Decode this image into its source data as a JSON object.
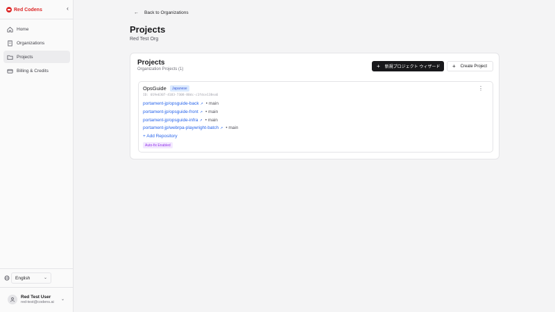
{
  "brand": {
    "name": "Red Codens"
  },
  "sidebar": {
    "items": [
      {
        "label": "Home",
        "icon": "home-icon"
      },
      {
        "label": "Organizations",
        "icon": "building-icon"
      },
      {
        "label": "Projects",
        "icon": "folder-icon",
        "active": true
      },
      {
        "label": "Billing & Credits",
        "icon": "credit-card-icon"
      }
    ],
    "language": "English",
    "user": {
      "name": "Red Test User",
      "email": "red-test@codens.ai"
    }
  },
  "header": {
    "back_label": "Back to Organizations",
    "title": "Projects",
    "subtitle": "Red Test Org"
  },
  "card": {
    "title": "Projects",
    "subtitle": "Organization Projects (1)",
    "wizard_label": "新規プロジェクト ウィザード",
    "create_label": "Create Project"
  },
  "project": {
    "name": "OpsGuide",
    "language": "Japanese",
    "id": "ID: 019e6307-4183-7308-80dc-c1fdce138ea6",
    "repos": [
      {
        "name": "portament-jp/opsguide-back",
        "branch": "• main"
      },
      {
        "name": "portament-jp/opsguide-front",
        "branch": "• main"
      },
      {
        "name": "portament-jp/opsguide-infra",
        "branch": "• main"
      },
      {
        "name": "portament-jp/webrpa-playwright-batch",
        "branch": "• main"
      }
    ],
    "add_repo_label": "+ Add Repository",
    "autofix_label": "Auto-fix Enabled"
  },
  "colors": {
    "brand": "#dc2626",
    "link": "#2563eb",
    "primary_button": "#18181b"
  }
}
